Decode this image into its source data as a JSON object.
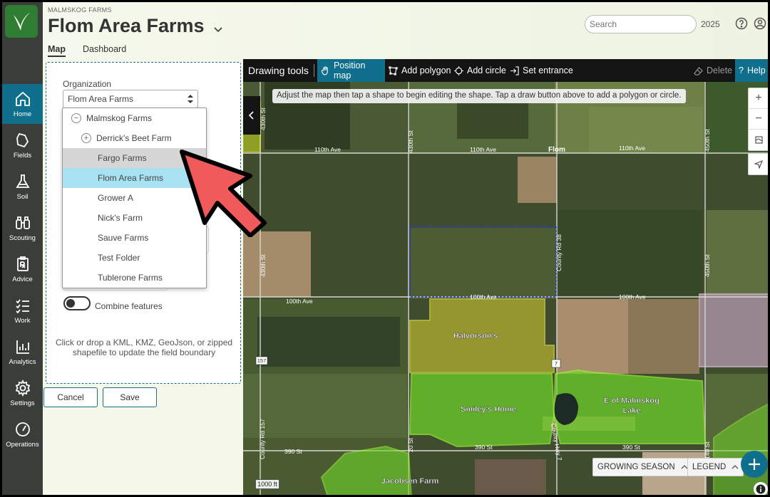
{
  "header": {
    "org_small": "MALMSKOG FARMS",
    "title": "Flom Area Farms",
    "tabs": [
      {
        "label": "Map"
      },
      {
        "label": "Dashboard"
      }
    ],
    "search_placeholder": "Search",
    "year": "2025"
  },
  "nav": {
    "items": [
      {
        "label": "Home",
        "icon": "home-icon"
      },
      {
        "label": "Fields",
        "icon": "fields-icon"
      },
      {
        "label": "Soil",
        "icon": "flask-icon"
      },
      {
        "label": "Scouting",
        "icon": "binoculars-icon"
      },
      {
        "label": "Advice",
        "icon": "prescription-icon"
      },
      {
        "label": "Work",
        "icon": "checklist-icon"
      },
      {
        "label": "Analytics",
        "icon": "chart-icon"
      },
      {
        "label": "Settings",
        "icon": "gear-icon"
      },
      {
        "label": "Operations",
        "icon": "gauge-icon"
      }
    ]
  },
  "panel": {
    "org_label": "Organization",
    "org_value": "Flom Area Farms",
    "combine_label": "Combine features",
    "upload_hint": "Click or drop a KML, KMZ, GeoJson, or zipped shapefile to update the field boundary",
    "cancel_label": "Cancel",
    "save_label": "Save"
  },
  "dropdown": {
    "items": [
      {
        "label": "Malmskog Farms",
        "toggle": "−"
      },
      {
        "label": "Derrick's Beet Farm",
        "toggle": "+"
      },
      {
        "label": "Fargo Farms"
      },
      {
        "label": "Flom Area Farms"
      },
      {
        "label": "Grower A"
      },
      {
        "label": "Nick's Farm"
      },
      {
        "label": "Sauve Farms"
      },
      {
        "label": "Test Folder"
      },
      {
        "label": "Tublerone Farms"
      }
    ]
  },
  "toolbar": {
    "title": "Drawing tools",
    "position_map": "Position map",
    "add_polygon": "Add polygon",
    "add_circle": "Add circle",
    "set_entrance": "Set entrance",
    "delete": "Delete",
    "help": "Help"
  },
  "map": {
    "hint": "Adjust the map then tap a shape to begin editing the shape. Tap a draw button above to add a polygon or circle.",
    "growing_season": "GROWING SEASON",
    "legend": "LEGEND",
    "scale": "1000 ft",
    "fields": [
      "Halvorson's",
      "Smiley's Home",
      "E of Malmskog",
      "Lake",
      "Jacobsen Farm"
    ],
    "roads": {
      "ave_110_a": "110th Ave",
      "ave_110_b": "110th Ave",
      "ave_110_c": "110th Ave",
      "flom": "Flom",
      "ave_100_a": "100th Ave",
      "ave_100_b": "100th Ave",
      "ave_100_c": "100th Ave",
      "st_390_a": "390 St",
      "st_390_b": "390 St",
      "st_390_c": "390 St",
      "st_430_a": "430th St",
      "st_430_b": "430th St",
      "st_430_c": "430th St",
      "st_450_a": "450th St",
      "st_450_b": "450th St",
      "county_rd_38": "County Rd 38",
      "county_rd_157": "County Rd 157",
      "county_hwy_7": "County Hwy 7",
      "st_20": "20 St",
      "st_140": "140 St",
      "shield_157": "157",
      "shield_7": "7"
    }
  },
  "colors": {
    "accent": "#0f6f8c",
    "nav_bg": "#3a3d3a",
    "field_yellow": "#e8e23a",
    "field_green": "#7be22c",
    "arrow_red": "#f05a5a"
  }
}
